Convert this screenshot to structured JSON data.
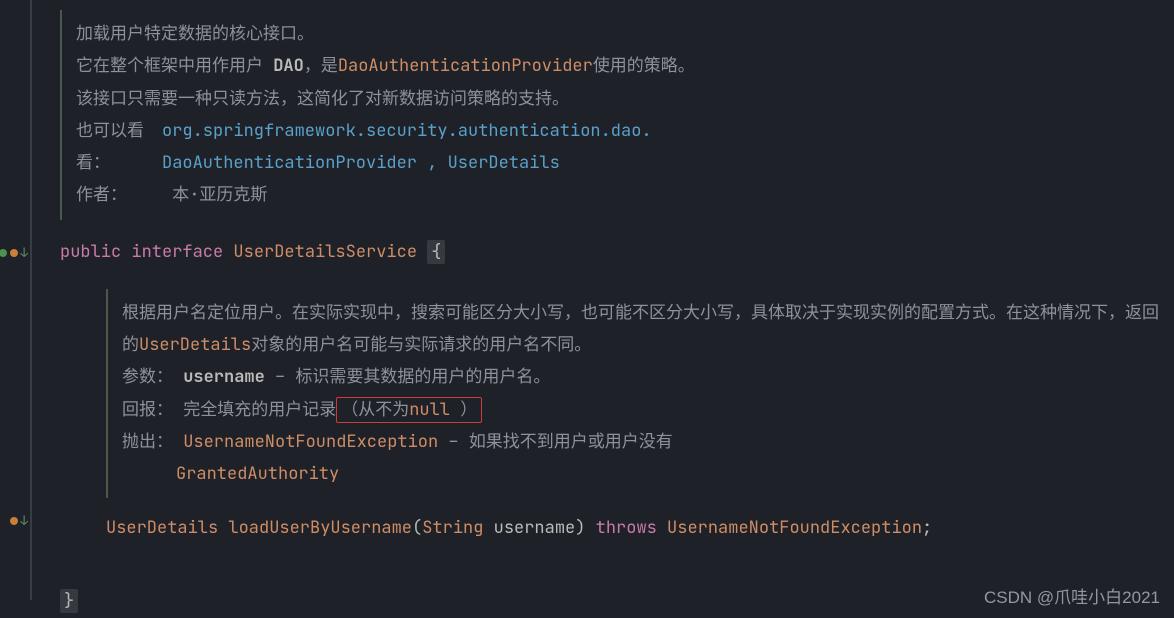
{
  "doc1": {
    "line1": "加载用户特定数据的核心接口。",
    "line2a": "它在整个框架中用作用户 ",
    "line2b": "DAO",
    "line2c": "，是",
    "line2d": "DaoAuthenticationProvider",
    "line2e": "使用的策略。",
    "line3": "该接口只需要一种只读方法，这简化了对新数据访问策略的支持。",
    "seeAlsoLabel": "也可以看看：",
    "seeAlso1": "org.springframework.security.authentication.dao.",
    "seeAlso2": "DaoAuthenticationProvider",
    "sep": " , ",
    "seeAlso3": "UserDetails",
    "authorLabel": "作者：",
    "authorValue": "本·亚历克斯"
  },
  "interfaceDecl": {
    "public": "public",
    "interface": "interface",
    "name": "UserDetailsService",
    "open": "{"
  },
  "doc2": {
    "desc1": "根据用户名定位用户。在实际实现中，搜索可能区分大小写，也可能不区分大小写，具体取决于实现实例的配置方式。在这种情况下，返回的",
    "desc2code": "UserDetails",
    "desc3": "对象的用户名可能与实际请求的用户名不同。",
    "paramLabel": "参数：",
    "paramName": "username",
    "paramDash": " – ",
    "paramDesc": "标识需要其数据的用户的用户名。",
    "returnLabel": "回报：",
    "returnDesc": "完全填充的用户记录",
    "returnBoxL": "（从不为",
    "returnNull": "null",
    "returnBoxR": " ）",
    "throwsLabel": "抛出：",
    "throwsType": "UsernameNotFoundException",
    "throwsDash": " – ",
    "throwsDesc": "如果找不到用户或用户没有",
    "throwsAuth": "GrantedAuthority"
  },
  "method": {
    "returnType": "UserDetails",
    "name": "loadUserByUsername",
    "lparen": "(",
    "paramType": "String",
    "paramName": "username",
    "rparen": ")",
    "throws": "throws",
    "exc": "UsernameNotFoundException",
    "semi": ";"
  },
  "close": {
    "brace": "}"
  },
  "watermark": "CSDN @爪哇小白2021",
  "chart_data": null
}
